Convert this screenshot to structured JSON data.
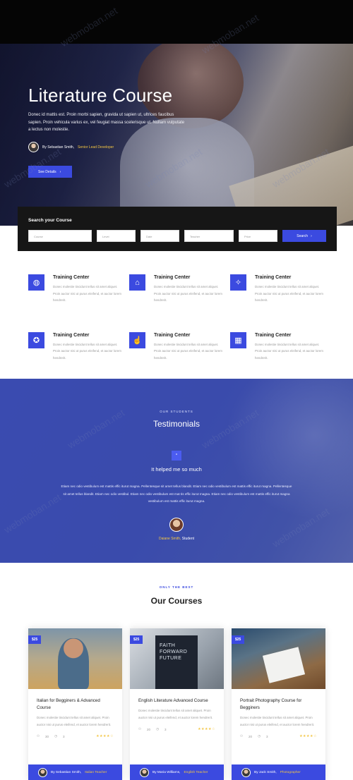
{
  "hero": {
    "title": "Literature Course",
    "text": "Donec id mattis est. Proin morbi sapien, gravida ut sapien ut, ultrices faucibus sapien. Proin vehicula varius ex, vel feugiat massa scelerisque ut. Nullam vulputate a lectus non molestie.",
    "author_prefix": "By Sebastian Smith,",
    "author_role": "Senior Lead Developer",
    "button_label": "See Details",
    "button_icon": "chevron-right-icon"
  },
  "search": {
    "title": "Search your Course",
    "fields": [
      "Course",
      "Level",
      "Date",
      "Teacher",
      "Price"
    ],
    "button_label": "Search"
  },
  "features": [
    {
      "title": "Training Center",
      "icon": "globe-icon",
      "text": "Donec molestie tincidunt tellus sit amet aliquet. Proin auctor nisi ut purus eleifend, et auctor lorem hendrerit."
    },
    {
      "title": "Training Center",
      "icon": "graduation-cap-icon",
      "text": "Donec molestie tincidunt tellus sit amet aliquet. Proin auctor nisi ut purus eleifend, et auctor lorem hendrerit."
    },
    {
      "title": "Training Center",
      "icon": "lightbulb-icon",
      "text": "Donec molestie tincidunt tellus sit amet aliquet. Proin auctor nisi ut purus eleifend, et auctor lorem hendrerit."
    },
    {
      "title": "Training Center",
      "icon": "medal-icon",
      "text": "Donec molestie tincidunt tellus sit amet aliquet. Proin auctor nisi ut purus eleifend, et auctor lorem hendrerit."
    },
    {
      "title": "Training Center",
      "icon": "touch-icon",
      "text": "Donec molestie tincidunt tellus sit amet aliquet. Proin auctor nisi ut purus eleifend, et auctor lorem hendrerit."
    },
    {
      "title": "Training Center",
      "icon": "school-building-icon",
      "text": "Donec molestie tincidunt tellus sit amet aliquet. Proin auctor nisi ut purus eleifend, et auctor lorem hendrerit."
    }
  ],
  "testimonials": {
    "overline": "OUR STUDENTS",
    "title": "Testimonials",
    "quote_title": "It helped me so much",
    "text": "Etiam nec odio vestibulum est mattis effic iturut magna. Pellentesque sit amet tellus blandit. Etiam nec odio vestibulum est mattis effic iturut magna. Pellentesque sit amet tellus blandit. Etiam nec odio vestibul. Etiam nec odio vestibulum est mat tis effic iturut magna. Etiam nec odio vestibulum est mattis effic iturut magna vestibulum est mattis effic iturut magna.",
    "student_name": "Daiane Smith,",
    "student_role": "Student"
  },
  "courses": {
    "overline": "ONLY THE BEST",
    "title": "Our Courses",
    "items": [
      {
        "price": "$25",
        "title": "Italian for Begginers & Advanced Course",
        "text": "Donec molestie tincidunt tellus sit amet aliquet. Proin auctor nisi ut purus eleifend, et auctor lorem hendrerit.",
        "students": "30",
        "lessons": "3",
        "stars": "★★★★☆",
        "author": "By Sebastian Smith,",
        "role": "Italian Teacher"
      },
      {
        "price": "$25",
        "title": "English Literature Advanced Course",
        "text": "Donec molestie tincidunt tellus sit amet aliquet. Proin auctor nisi ut purus eleifend, et auctor lorem hendrerit.",
        "students": "20",
        "lessons": "3",
        "stars": "★★★★☆",
        "author": "By Maria Williams,",
        "role": "English Teacher"
      },
      {
        "price": "$25",
        "title": "Portrait Photography Course for Begginers",
        "text": "Donec molestie tincidunt tellus sit amet aliquet. Proin auctor nisi ut purus eleifend, et auctor lorem hendrerit.",
        "students": "20",
        "lessons": "3",
        "stars": "★★★★☆",
        "author": "By Jack Smith,",
        "role": "Photographer"
      }
    ]
  },
  "watermark": "webmoban.net",
  "colors": {
    "accent": "#3b4ae0",
    "gold": "#f3c643",
    "dark": "#161616"
  }
}
